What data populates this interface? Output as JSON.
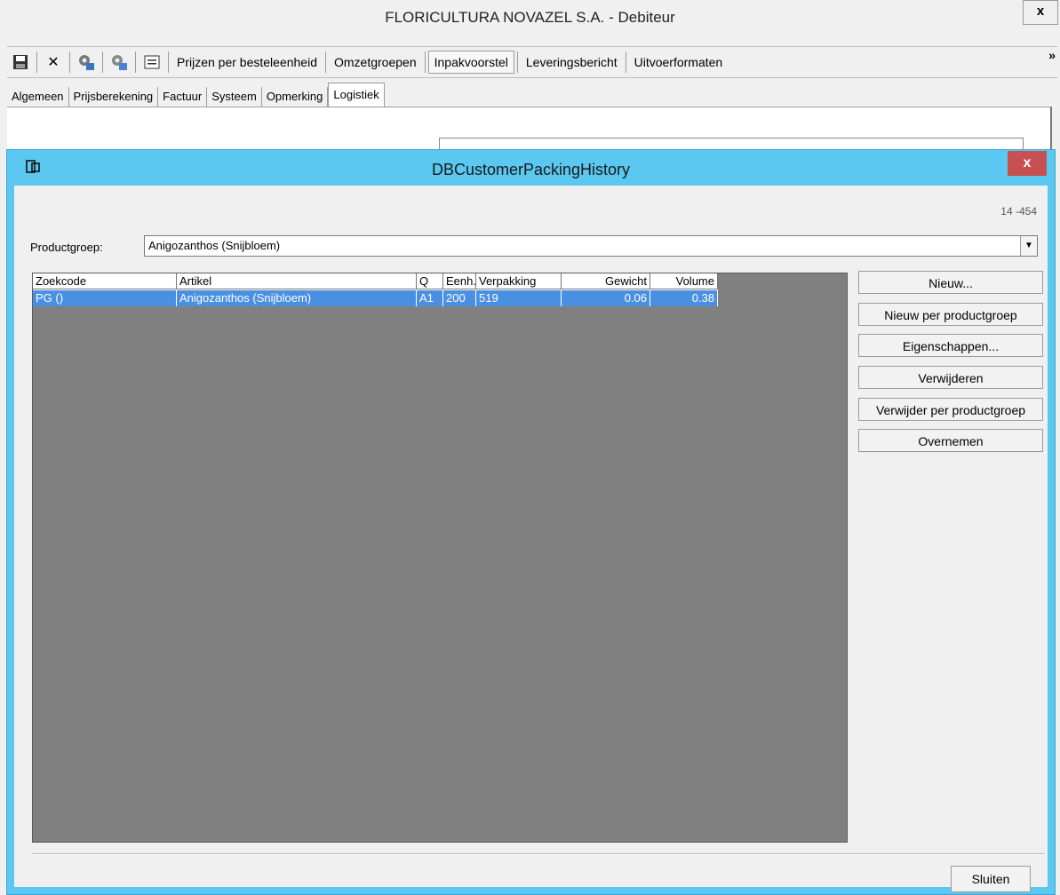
{
  "main_window": {
    "title": "FLORICULTURA NOVAZEL S.A. - Debiteur",
    "close_label": "x",
    "toolbar": {
      "icons": [
        "save-icon",
        "delete-icon",
        "gear-left-icon",
        "gear-right-icon",
        "list-icon"
      ],
      "delete_glyph": "✕",
      "buttons": [
        "Prijzen per besteleenheid",
        "Omzetgroepen",
        "Inpakvoorstel",
        "Leveringsbericht",
        "Uitvoerformaten"
      ],
      "active_button": "Inpakvoorstel",
      "overflow": "»"
    },
    "tabs": [
      "Algemeen",
      "Prijsberekening",
      "Factuur",
      "Systeem",
      "Opmerking",
      "Logistiek"
    ],
    "active_tab": "Logistiek"
  },
  "dialog": {
    "title": "DBCustomerPackingHistory",
    "close_label": "x",
    "code": "14 -454",
    "productgroep_label": "Productgroep:",
    "productgroep_value": "Anigozanthos (Snijbloem)",
    "grid": {
      "columns": [
        "Zoekcode",
        "Artikel",
        "Q",
        "Eenh.",
        "Verpakking",
        "Gewicht",
        "Volume"
      ],
      "rows": [
        {
          "zoekcode": "PG ()",
          "artikel": "Anigozanthos (Snijbloem)",
          "q": "A1",
          "eenh": "200",
          "verpakking": "519",
          "gewicht": "0.06",
          "volume": "0.38",
          "selected": true
        }
      ]
    },
    "buttons": {
      "nieuw": "Nieuw...",
      "nieuw_per_productgroep": "Nieuw per productgroep",
      "eigenschappen": "Eigenschappen...",
      "verwijderen": "Verwijderen",
      "verwijder_per_productgroep": "Verwijder per productgroep",
      "overnemen": "Overnemen",
      "sluiten": "Sluiten"
    },
    "colors": {
      "title_bar": "#5ac8f0",
      "selection": "#4a90e2",
      "grid_background": "#808080",
      "close_button": "#c75050"
    }
  }
}
